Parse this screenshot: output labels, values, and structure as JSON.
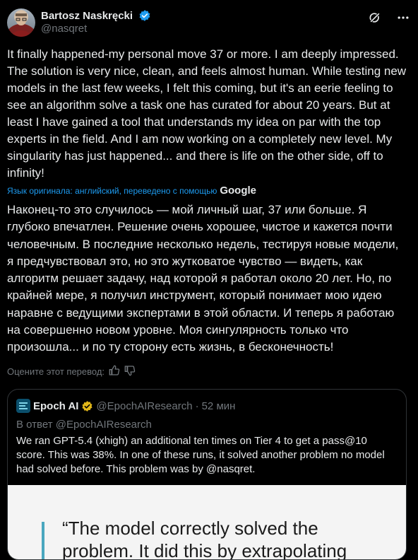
{
  "author": {
    "name": "Bartosz Naskręcki",
    "handle": "@nasqret",
    "avatar_icon": "avatar-icon",
    "verified_color": "#1d9bf0"
  },
  "tweet": {
    "text": "It finally happened-my personal move 37 or more. I am deeply impressed. The solution is very nice, clean, and feels almost human. While testing new models in the last few weeks, I felt this coming, but it's an eerie feeling to see an algorithm solve a task one has curated for about 20 years. But at least I have gained a tool that understands my idea on par with the top experts in the field. And I am now working on a completely new level. My singularity has just happened... and there is life on the other side, off to infinity!"
  },
  "translation": {
    "note": "Язык оригинала: английский, переведено с помощью",
    "provider": "Google",
    "text": "Наконец-то это случилось — мой личный шаг, 37 или больше. Я глубоко впечатлен. Решение очень хорошее, чистое и кажется почти человечным. В последние несколько недель, тестируя новые модели, я предчувствовал это, но это жутковатое чувство — видеть, как алгоритм решает задачу, над которой я работал около 20 лет. Но, по крайней мере, я получил инструмент, который понимает мою идею наравне с ведущими экспертами в этой области. И теперь я работаю на совершенно новом уровне. Моя сингулярность только что произошла... и по ту сторону есть жизнь, в бесконечность!",
    "rate_label": "Оцените этот перевод:"
  },
  "quote": {
    "name": "Epoch AI",
    "handle": "@EpochAIResearch",
    "separator": "·",
    "time": "52 мин",
    "reply_to": "В ответ @EpochAIResearch",
    "text": "We ran GPT-5.4 (xhigh) an additional ten times on Tier 4 to get a pass@10 score. This was 38%. In one of these runs, it solved another problem no model had solved before. This problem was by @nasqret.",
    "image_quote": "“The model correctly solved the problem. It did this by extrapolating"
  }
}
